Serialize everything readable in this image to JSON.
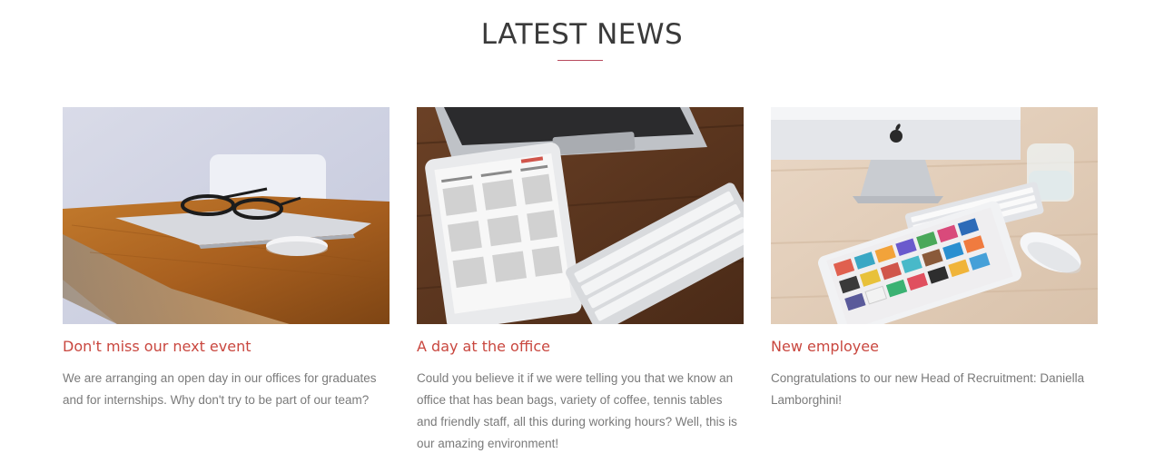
{
  "section": {
    "heading": "LATEST NEWS",
    "accent_color": "#c9473f",
    "divider_color": "#b84a5e"
  },
  "posts": [
    {
      "image_icon": "laptop-glasses-desk-photo",
      "title": "Don't miss our next event",
      "excerpt": "We are arranging an open day in our offices for graduates and for internships. Why don't try to be part of our team?"
    },
    {
      "image_icon": "tablet-keyboard-desk-photo",
      "title": "A day at the office",
      "excerpt": "Could you believe it if we were telling you that we know an office that has bean bags, variety of coffee, tennis tables and friendly staff, all this during working hours? Well, this is our amazing environment!"
    },
    {
      "image_icon": "imac-ipad-desk-photo",
      "title": "New employee",
      "excerpt": "Congratulations to our new Head of Recruitment: Daniella Lamborghini!"
    }
  ]
}
